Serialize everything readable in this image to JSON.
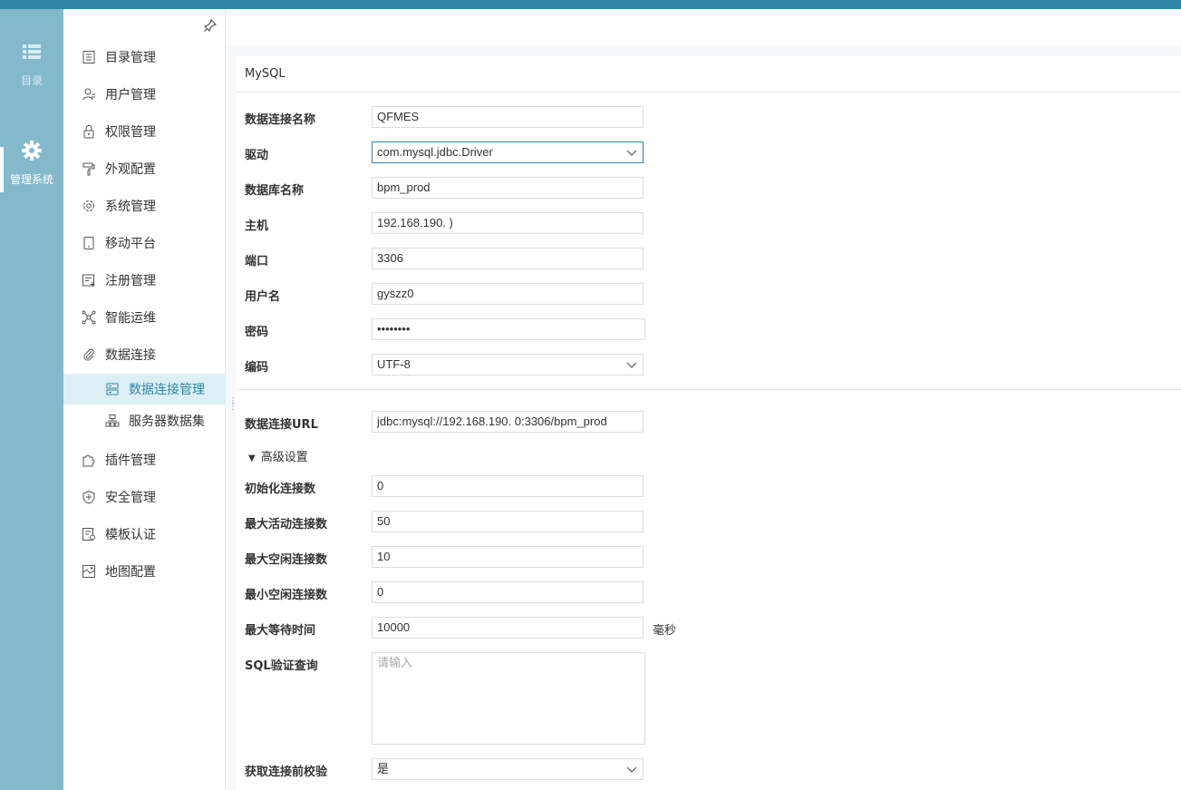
{
  "rail": {
    "items": [
      {
        "label": "目录",
        "icon": "list-icon"
      },
      {
        "label": "管理系统",
        "icon": "gear-icon"
      }
    ]
  },
  "menu": {
    "items": [
      {
        "label": "目录管理",
        "icon": "catalog-icon"
      },
      {
        "label": "用户管理",
        "icon": "user-icon"
      },
      {
        "label": "权限管理",
        "icon": "lock-icon"
      },
      {
        "label": "外观配置",
        "icon": "paint-roller-icon"
      },
      {
        "label": "系统管理",
        "icon": "settings-icon"
      },
      {
        "label": "移动平台",
        "icon": "tablet-icon"
      },
      {
        "label": "注册管理",
        "icon": "register-icon"
      },
      {
        "label": "智能运维",
        "icon": "network-icon"
      },
      {
        "label": "数据连接",
        "icon": "link-icon"
      },
      {
        "label": "数据连接管理",
        "icon": "database-icon",
        "active": true,
        "sub": true
      },
      {
        "label": "服务器数据集",
        "icon": "server-dataset-icon",
        "sub": true
      },
      {
        "label": "插件管理",
        "icon": "plugin-icon"
      },
      {
        "label": "安全管理",
        "icon": "shield-icon"
      },
      {
        "label": "模板认证",
        "icon": "template-auth-icon"
      },
      {
        "label": "地图配置",
        "icon": "map-icon"
      }
    ]
  },
  "form": {
    "section_title": "MySQL",
    "connection_name": {
      "label": "数据连接名称",
      "value": "QFMES"
    },
    "driver": {
      "label": "驱动",
      "value": "com.mysql.jdbc.Driver"
    },
    "database": {
      "label": "数据库名称",
      "value": "bpm_prod"
    },
    "host": {
      "label": "主机",
      "value": "192.168.190.  )"
    },
    "port": {
      "label": "端口",
      "value": "3306"
    },
    "username": {
      "label": "用户名",
      "value": "gyszz0"
    },
    "password": {
      "label": "密码",
      "value": "••••••••"
    },
    "encoding": {
      "label": "编码",
      "value": "UTF-8"
    },
    "url": {
      "label": "数据连接URL",
      "value": "jdbc:mysql://192.168.190.  0:3306/bpm_prod"
    },
    "advanced_label": "高级设置",
    "initial_size": {
      "label": "初始化连接数",
      "value": "0"
    },
    "max_active": {
      "label": "最大活动连接数",
      "value": "50"
    },
    "max_idle": {
      "label": "最大空闲连接数",
      "value": "10"
    },
    "min_idle": {
      "label": "最小空闲连接数",
      "value": "0"
    },
    "max_wait": {
      "label": "最大等待时间",
      "value": "10000",
      "unit": "毫秒"
    },
    "validation_query": {
      "label": "SQL验证查询",
      "placeholder": "请输入"
    },
    "test_on_borrow": {
      "label": "获取连接前校验",
      "value": "是"
    }
  }
}
